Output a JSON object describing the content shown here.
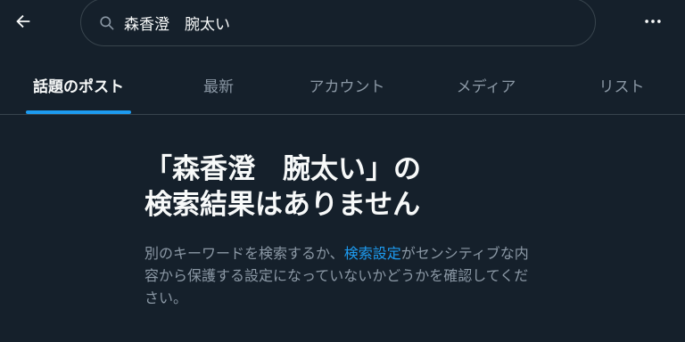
{
  "header": {
    "search_value": "森香澄　腕太い",
    "colors": {
      "background": "#15202b",
      "accent": "#1d9bf0",
      "muted": "#8b98a5",
      "border": "#38444d"
    },
    "icons": {
      "back": "arrow-left-icon",
      "search": "search-icon",
      "more": "more-horizontal-icon"
    }
  },
  "tabs": [
    {
      "label": "話題のポスト",
      "active": true
    },
    {
      "label": "最新",
      "active": false
    },
    {
      "label": "アカウント",
      "active": false
    },
    {
      "label": "メディア",
      "active": false
    },
    {
      "label": "リスト",
      "active": false
    }
  ],
  "empty_state": {
    "title": "「森香澄　腕太い」の\n検索結果はありません",
    "description_before": "別のキーワードを検索するか、",
    "description_link": "検索設定",
    "description_after": "がセンシティブな内容から保護する設定になっていないかどうかを確認してください。"
  }
}
